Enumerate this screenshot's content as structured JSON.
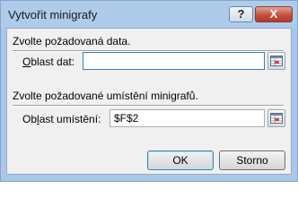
{
  "window": {
    "title": "Vytvořit minigrafy",
    "help_label": "?",
    "close_label": "X"
  },
  "data_section": {
    "heading": "Zvolte požadovaná data.",
    "field_label_accel": "O",
    "field_label_rest": "blast dat:",
    "value": ""
  },
  "location_section": {
    "heading": "Zvolte požadované umístění minigrafů.",
    "field_label_pre": "Ob",
    "field_label_accel": "l",
    "field_label_rest": "ast umístění:",
    "value": "$F$2"
  },
  "buttons": {
    "ok_label": "OK",
    "cancel_label": "Storno"
  },
  "icons": {
    "range_selector": "range-select-icon"
  }
}
